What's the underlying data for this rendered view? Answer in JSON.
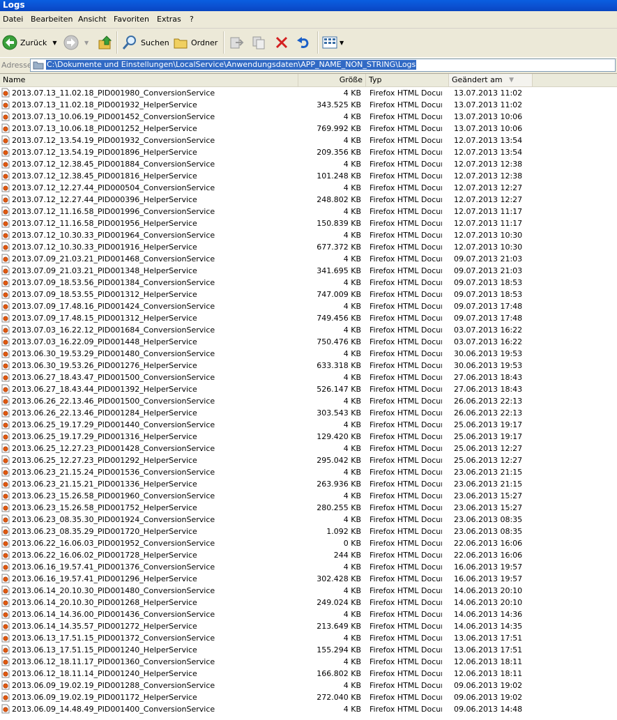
{
  "window": {
    "title": "Logs"
  },
  "menu": [
    "Datei",
    "Bearbeiten",
    "Ansicht",
    "Favoriten",
    "Extras",
    "?"
  ],
  "toolbar": {
    "back_label": "Zurück",
    "search_label": "Suchen",
    "folders_label": "Ordner"
  },
  "address": {
    "label": "Adresse",
    "path": "C:\\Dokumente und Einstellungen\\LocalService\\Anwendungsdaten\\APP_NAME_NON_STRING\\Logs"
  },
  "columns": {
    "name": "Name",
    "size": "Größe",
    "type": "Typ",
    "modified": "Geändert am"
  },
  "files": [
    {
      "name": "2013.07.13_11.02.18_PID001980_ConversionService",
      "size": "4 KB",
      "type": "Firefox HTML Document",
      "date": "13.07.2013 11:02"
    },
    {
      "name": "2013.07.13_11.02.18_PID001932_HelperService",
      "size": "343.525 KB",
      "type": "Firefox HTML Document",
      "date": "13.07.2013 11:02"
    },
    {
      "name": "2013.07.13_10.06.19_PID001452_ConversionService",
      "size": "4 KB",
      "type": "Firefox HTML Document",
      "date": "13.07.2013 10:06"
    },
    {
      "name": "2013.07.13_10.06.18_PID001252_HelperService",
      "size": "769.992 KB",
      "type": "Firefox HTML Document",
      "date": "13.07.2013 10:06"
    },
    {
      "name": "2013.07.12_13.54.19_PID001932_ConversionService",
      "size": "4 KB",
      "type": "Firefox HTML Document",
      "date": "12.07.2013 13:54"
    },
    {
      "name": "2013.07.12_13.54.19_PID001896_HelperService",
      "size": "209.356 KB",
      "type": "Firefox HTML Document",
      "date": "12.07.2013 13:54"
    },
    {
      "name": "2013.07.12_12.38.45_PID001884_ConversionService",
      "size": "4 KB",
      "type": "Firefox HTML Document",
      "date": "12.07.2013 12:38"
    },
    {
      "name": "2013.07.12_12.38.45_PID001816_HelperService",
      "size": "101.248 KB",
      "type": "Firefox HTML Document",
      "date": "12.07.2013 12:38"
    },
    {
      "name": "2013.07.12_12.27.44_PID000504_ConversionService",
      "size": "4 KB",
      "type": "Firefox HTML Document",
      "date": "12.07.2013 12:27"
    },
    {
      "name": "2013.07.12_12.27.44_PID000396_HelperService",
      "size": "248.802 KB",
      "type": "Firefox HTML Document",
      "date": "12.07.2013 12:27"
    },
    {
      "name": "2013.07.12_11.16.58_PID001996_ConversionService",
      "size": "4 KB",
      "type": "Firefox HTML Document",
      "date": "12.07.2013 11:17"
    },
    {
      "name": "2013.07.12_11.16.58_PID001956_HelperService",
      "size": "150.839 KB",
      "type": "Firefox HTML Document",
      "date": "12.07.2013 11:17"
    },
    {
      "name": "2013.07.12_10.30.33_PID001964_ConversionService",
      "size": "4 KB",
      "type": "Firefox HTML Document",
      "date": "12.07.2013 10:30"
    },
    {
      "name": "2013.07.12_10.30.33_PID001916_HelperService",
      "size": "677.372 KB",
      "type": "Firefox HTML Document",
      "date": "12.07.2013 10:30"
    },
    {
      "name": "2013.07.09_21.03.21_PID001468_ConversionService",
      "size": "4 KB",
      "type": "Firefox HTML Document",
      "date": "09.07.2013 21:03"
    },
    {
      "name": "2013.07.09_21.03.21_PID001348_HelperService",
      "size": "341.695 KB",
      "type": "Firefox HTML Document",
      "date": "09.07.2013 21:03"
    },
    {
      "name": "2013.07.09_18.53.56_PID001384_ConversionService",
      "size": "4 KB",
      "type": "Firefox HTML Document",
      "date": "09.07.2013 18:53"
    },
    {
      "name": "2013.07.09_18.53.55_PID001312_HelperService",
      "size": "747.009 KB",
      "type": "Firefox HTML Document",
      "date": "09.07.2013 18:53"
    },
    {
      "name": "2013.07.09_17.48.16_PID001424_ConversionService",
      "size": "4 KB",
      "type": "Firefox HTML Document",
      "date": "09.07.2013 17:48"
    },
    {
      "name": "2013.07.09_17.48.15_PID001312_HelperService",
      "size": "749.456 KB",
      "type": "Firefox HTML Document",
      "date": "09.07.2013 17:48"
    },
    {
      "name": "2013.07.03_16.22.12_PID001684_ConversionService",
      "size": "4 KB",
      "type": "Firefox HTML Document",
      "date": "03.07.2013 16:22"
    },
    {
      "name": "2013.07.03_16.22.09_PID001448_HelperService",
      "size": "750.476 KB",
      "type": "Firefox HTML Document",
      "date": "03.07.2013 16:22"
    },
    {
      "name": "2013.06.30_19.53.29_PID001480_ConversionService",
      "size": "4 KB",
      "type": "Firefox HTML Document",
      "date": "30.06.2013 19:53"
    },
    {
      "name": "2013.06.30_19.53.26_PID001276_HelperService",
      "size": "633.318 KB",
      "type": "Firefox HTML Document",
      "date": "30.06.2013 19:53"
    },
    {
      "name": "2013.06.27_18.43.47_PID001500_ConversionService",
      "size": "4 KB",
      "type": "Firefox HTML Document",
      "date": "27.06.2013 18:43"
    },
    {
      "name": "2013.06.27_18.43.44_PID001392_HelperService",
      "size": "526.147 KB",
      "type": "Firefox HTML Document",
      "date": "27.06.2013 18:43"
    },
    {
      "name": "2013.06.26_22.13.46_PID001500_ConversionService",
      "size": "4 KB",
      "type": "Firefox HTML Document",
      "date": "26.06.2013 22:13"
    },
    {
      "name": "2013.06.26_22.13.46_PID001284_HelperService",
      "size": "303.543 KB",
      "type": "Firefox HTML Document",
      "date": "26.06.2013 22:13"
    },
    {
      "name": "2013.06.25_19.17.29_PID001440_ConversionService",
      "size": "4 KB",
      "type": "Firefox HTML Document",
      "date": "25.06.2013 19:17"
    },
    {
      "name": "2013.06.25_19.17.29_PID001316_HelperService",
      "size": "129.420 KB",
      "type": "Firefox HTML Document",
      "date": "25.06.2013 19:17"
    },
    {
      "name": "2013.06.25_12.27.23_PID001428_ConversionService",
      "size": "4 KB",
      "type": "Firefox HTML Document",
      "date": "25.06.2013 12:27"
    },
    {
      "name": "2013.06.25_12.27.23_PID001292_HelperService",
      "size": "295.042 KB",
      "type": "Firefox HTML Document",
      "date": "25.06.2013 12:27"
    },
    {
      "name": "2013.06.23_21.15.24_PID001536_ConversionService",
      "size": "4 KB",
      "type": "Firefox HTML Document",
      "date": "23.06.2013 21:15"
    },
    {
      "name": "2013.06.23_21.15.21_PID001336_HelperService",
      "size": "263.936 KB",
      "type": "Firefox HTML Document",
      "date": "23.06.2013 21:15"
    },
    {
      "name": "2013.06.23_15.26.58_PID001960_ConversionService",
      "size": "4 KB",
      "type": "Firefox HTML Document",
      "date": "23.06.2013 15:27"
    },
    {
      "name": "2013.06.23_15.26.58_PID001752_HelperService",
      "size": "280.255 KB",
      "type": "Firefox HTML Document",
      "date": "23.06.2013 15:27"
    },
    {
      "name": "2013.06.23_08.35.30_PID001924_ConversionService",
      "size": "4 KB",
      "type": "Firefox HTML Document",
      "date": "23.06.2013 08:35"
    },
    {
      "name": "2013.06.23_08.35.29_PID001720_HelperService",
      "size": "1.092 KB",
      "type": "Firefox HTML Document",
      "date": "23.06.2013 08:35"
    },
    {
      "name": "2013.06.22_16.06.03_PID001952_ConversionService",
      "size": "0 KB",
      "type": "Firefox HTML Document",
      "date": "22.06.2013 16:06"
    },
    {
      "name": "2013.06.22_16.06.02_PID001728_HelperService",
      "size": "244 KB",
      "type": "Firefox HTML Document",
      "date": "22.06.2013 16:06"
    },
    {
      "name": "2013.06.16_19.57.41_PID001376_ConversionService",
      "size": "4 KB",
      "type": "Firefox HTML Document",
      "date": "16.06.2013 19:57"
    },
    {
      "name": "2013.06.16_19.57.41_PID001296_HelperService",
      "size": "302.428 KB",
      "type": "Firefox HTML Document",
      "date": "16.06.2013 19:57"
    },
    {
      "name": "2013.06.14_20.10.30_PID001480_ConversionService",
      "size": "4 KB",
      "type": "Firefox HTML Document",
      "date": "14.06.2013 20:10"
    },
    {
      "name": "2013.06.14_20.10.30_PID001268_HelperService",
      "size": "249.024 KB",
      "type": "Firefox HTML Document",
      "date": "14.06.2013 20:10"
    },
    {
      "name": "2013.06.14_14.36.00_PID001436_ConversionService",
      "size": "4 KB",
      "type": "Firefox HTML Document",
      "date": "14.06.2013 14:36"
    },
    {
      "name": "2013.06.14_14.35.57_PID001272_HelperService",
      "size": "213.649 KB",
      "type": "Firefox HTML Document",
      "date": "14.06.2013 14:35"
    },
    {
      "name": "2013.06.13_17.51.15_PID001372_ConversionService",
      "size": "4 KB",
      "type": "Firefox HTML Document",
      "date": "13.06.2013 17:51"
    },
    {
      "name": "2013.06.13_17.51.15_PID001240_HelperService",
      "size": "155.294 KB",
      "type": "Firefox HTML Document",
      "date": "13.06.2013 17:51"
    },
    {
      "name": "2013.06.12_18.11.17_PID001360_ConversionService",
      "size": "4 KB",
      "type": "Firefox HTML Document",
      "date": "12.06.2013 18:11"
    },
    {
      "name": "2013.06.12_18.11.14_PID001240_HelperService",
      "size": "166.802 KB",
      "type": "Firefox HTML Document",
      "date": "12.06.2013 18:11"
    },
    {
      "name": "2013.06.09_19.02.19_PID001288_ConversionService",
      "size": "4 KB",
      "type": "Firefox HTML Document",
      "date": "09.06.2013 19:02"
    },
    {
      "name": "2013.06.09_19.02.19_PID001172_HelperService",
      "size": "272.040 KB",
      "type": "Firefox HTML Document",
      "date": "09.06.2013 19:02"
    },
    {
      "name": "2013.06.09_14.48.49_PID001400_ConversionService",
      "size": "4 KB",
      "type": "Firefox HTML Document",
      "date": "09.06.2013 14:48"
    }
  ]
}
